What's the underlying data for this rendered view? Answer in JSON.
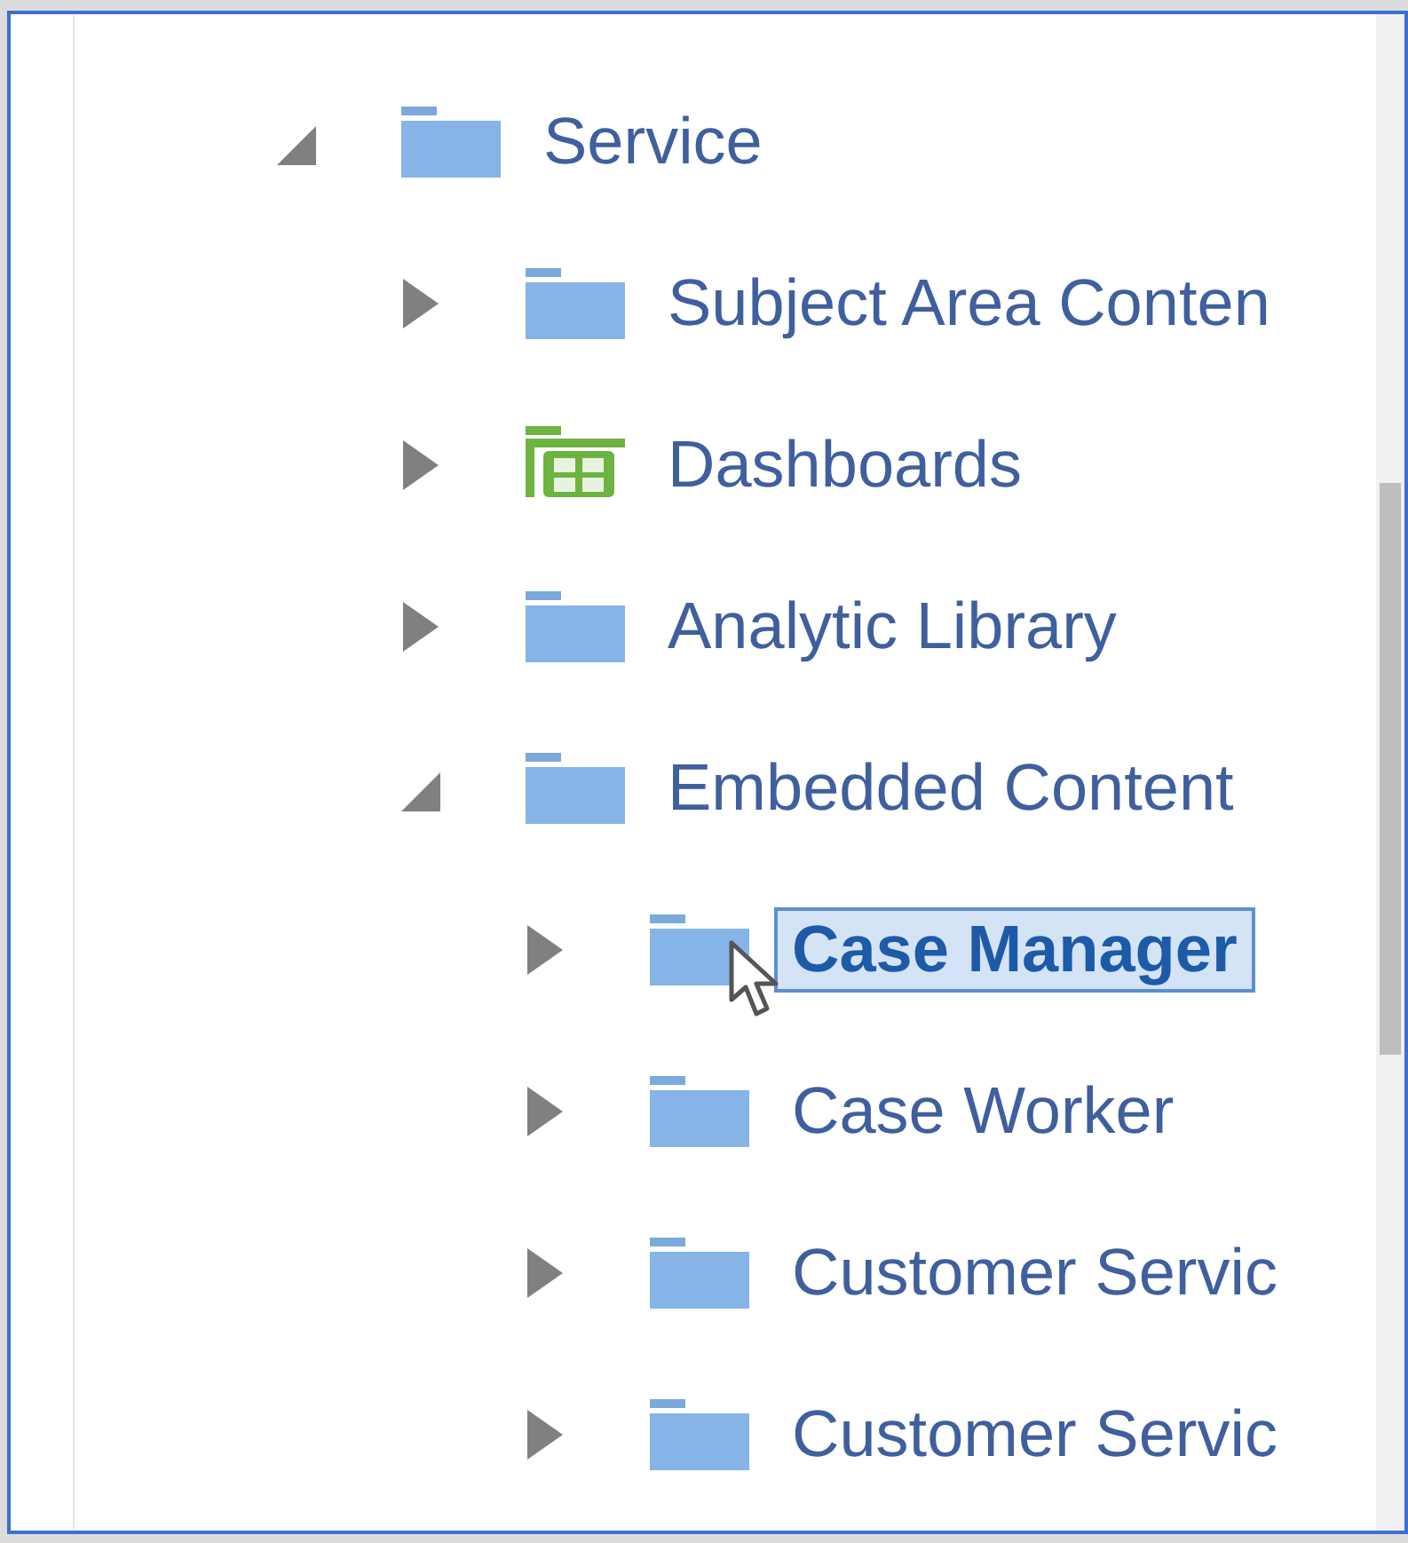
{
  "tree": [
    {
      "label": "Service",
      "kind": "folder",
      "expanded": true,
      "selected": false,
      "children": [
        {
          "label": "Subject Area Conten",
          "kind": "folder",
          "expanded": false,
          "selected": false
        },
        {
          "label": "Dashboards",
          "kind": "dashboard",
          "expanded": false,
          "selected": false
        },
        {
          "label": "Analytic Library",
          "kind": "folder",
          "expanded": false,
          "selected": false
        },
        {
          "label": "Embedded Content",
          "kind": "folder",
          "expanded": true,
          "selected": false,
          "children": [
            {
              "label": "Case Manager",
              "kind": "folder",
              "expanded": false,
              "selected": true
            },
            {
              "label": "Case Worker",
              "kind": "folder",
              "expanded": false,
              "selected": false
            },
            {
              "label": "Customer Servic",
              "kind": "folder",
              "expanded": false,
              "selected": false
            },
            {
              "label": "Customer Servic",
              "kind": "folder",
              "expanded": false,
              "selected": false
            }
          ]
        }
      ]
    }
  ]
}
